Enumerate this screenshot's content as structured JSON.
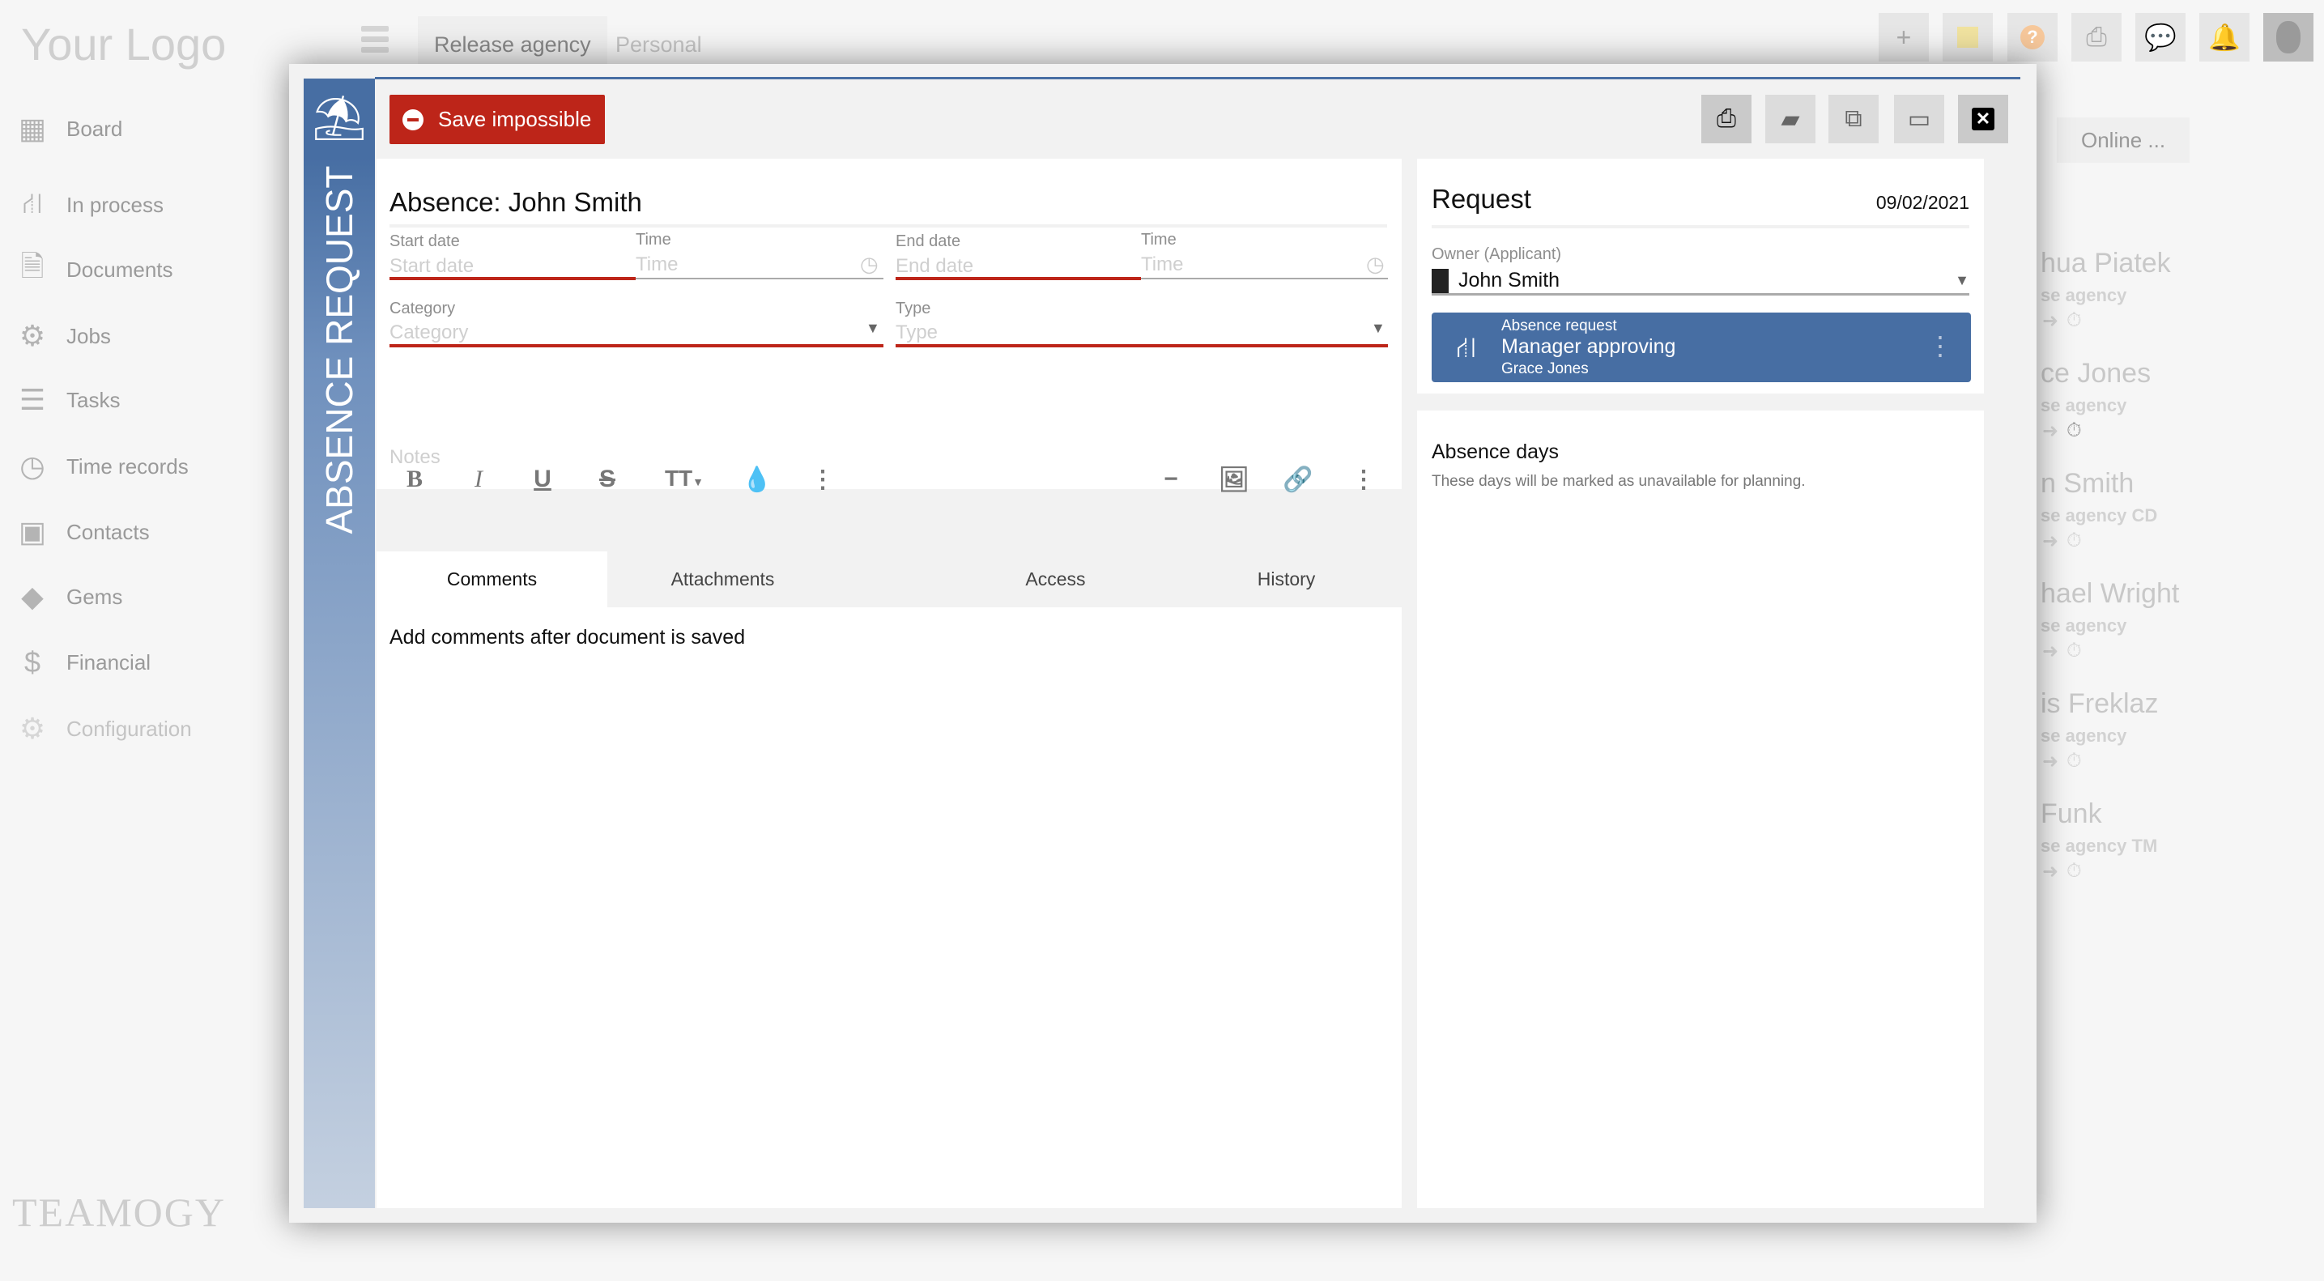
{
  "header": {
    "logo": "Your Logo",
    "tabs": [
      {
        "label": "Release agency"
      },
      {
        "label": "Personal"
      }
    ],
    "icons": [
      "plus-icon",
      "sticky-note-icon",
      "help-icon",
      "print-icon",
      "chat-icon",
      "bell-icon",
      "avatar"
    ]
  },
  "sidebar": {
    "items": [
      {
        "label": "Board",
        "icon": "grid-icon"
      },
      {
        "label": "In process",
        "icon": "workflow-icon"
      },
      {
        "label": "Documents",
        "icon": "document-icon"
      },
      {
        "label": "Jobs",
        "icon": "gears-icon"
      },
      {
        "label": "Tasks",
        "icon": "tasks-icon"
      },
      {
        "label": "Time records",
        "icon": "clock-icon"
      },
      {
        "label": "Contacts",
        "icon": "contact-icon"
      },
      {
        "label": "Gems",
        "icon": "gem-icon"
      },
      {
        "label": "Financial",
        "icon": "dollar-icon"
      },
      {
        "label": "Configuration",
        "icon": "gear-icon"
      }
    ],
    "brand": "TEAMOGY"
  },
  "background": {
    "breadcrumb": "Online ...",
    "people": [
      {
        "name": "hua Piatek",
        "sub": "se agency"
      },
      {
        "name": "ce Jones",
        "sub": "se agency"
      },
      {
        "name": "n Smith",
        "sub": "se agency CD"
      },
      {
        "name": "hael Wright",
        "sub": "se agency"
      },
      {
        "name": "is Freklaz",
        "sub": "se agency"
      },
      {
        "name": "Funk",
        "sub": "se agency TM"
      }
    ]
  },
  "modal": {
    "side_title": "ABSENCE REQUEST",
    "save_label": "Save impossible",
    "toolbar": [
      "print-icon",
      "note-icon",
      "copy-icon",
      "maximize-icon",
      "close-icon"
    ],
    "title": "Absence: John Smith",
    "fields": {
      "start_date": {
        "label": "Start date",
        "placeholder": "Start date"
      },
      "start_time": {
        "label": "Time",
        "placeholder": "Time"
      },
      "end_date": {
        "label": "End date",
        "placeholder": "End date"
      },
      "end_time": {
        "label": "Time",
        "placeholder": "Time"
      },
      "category": {
        "label": "Category",
        "placeholder": "Category"
      },
      "type": {
        "label": "Type",
        "placeholder": "Type"
      }
    },
    "notes_placeholder": "Notes",
    "tabs": [
      {
        "label": "Comments",
        "active": true
      },
      {
        "label": "Attachments"
      },
      {
        "label": "Access"
      },
      {
        "label": "History"
      }
    ],
    "comments_text": "Add comments after document is saved",
    "request": {
      "title": "Request",
      "date": "09/02/2021",
      "owner_label": "Owner (Applicant)",
      "owner": "John Smith",
      "workflow": {
        "name": "Absence request",
        "state": "Manager approving",
        "assignee": "Grace Jones"
      }
    },
    "absence_days": {
      "title": "Absence days",
      "description": "These days will be marked as unavailable for planning."
    }
  },
  "colors": {
    "accent": "#476ea3",
    "error": "#bd2519",
    "help": "#f7c89b"
  }
}
